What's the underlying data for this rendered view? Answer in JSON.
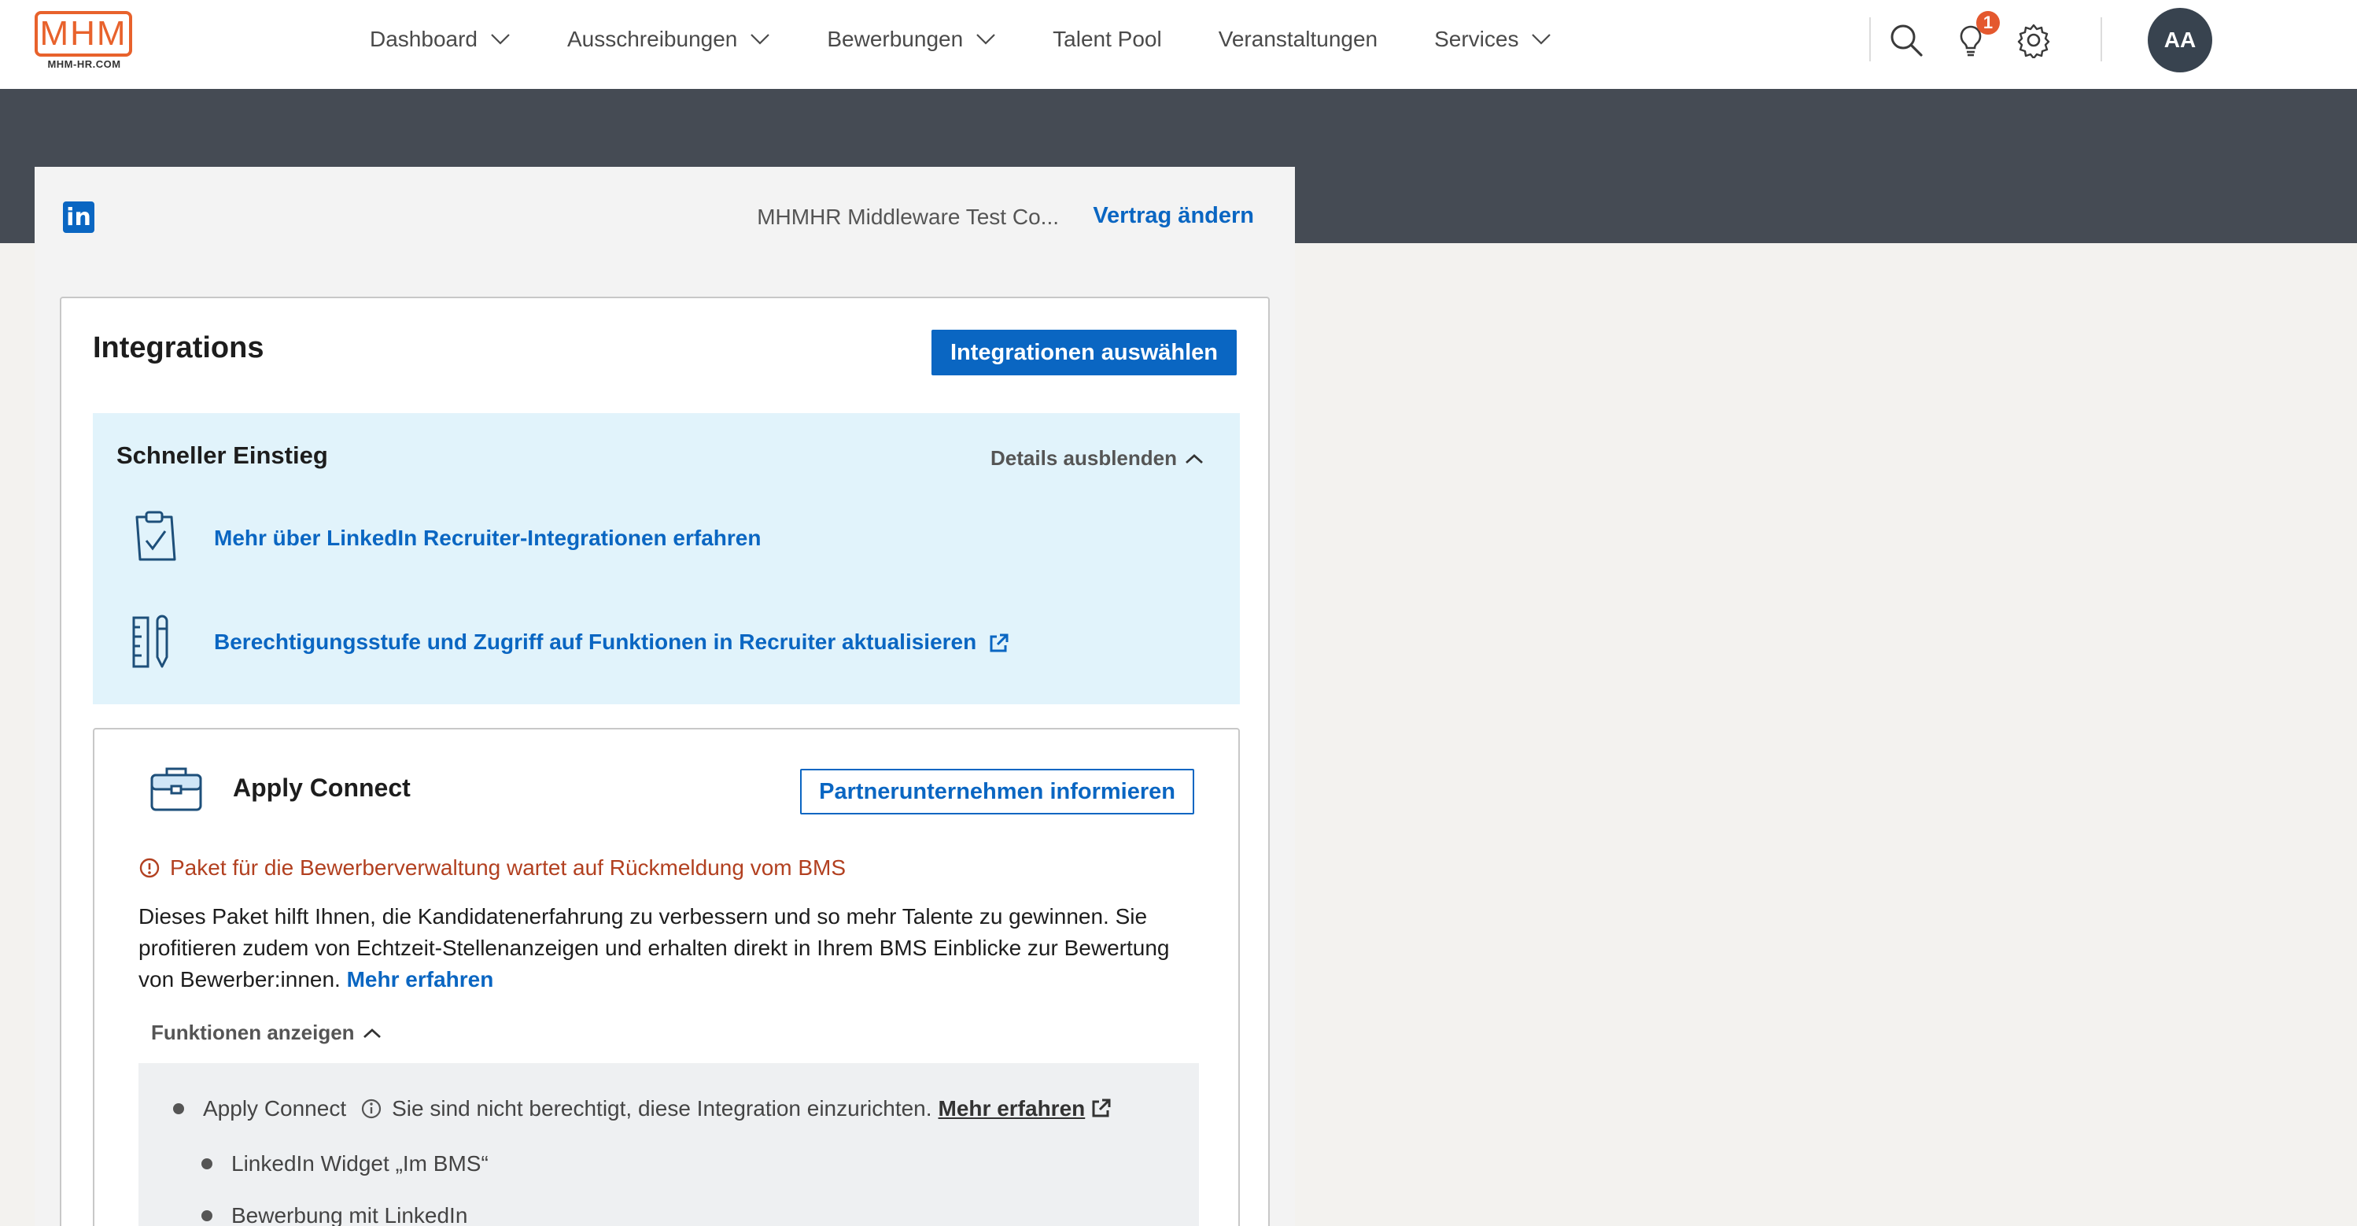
{
  "brand": {
    "logo_text": "MHM",
    "logo_subtext": "MHM-HR.COM",
    "accent": "#e8622c"
  },
  "nav": {
    "items": [
      {
        "label": "Dashboard",
        "has_dropdown": true
      },
      {
        "label": "Ausschreibungen",
        "has_dropdown": true
      },
      {
        "label": "Bewerbungen",
        "has_dropdown": true
      },
      {
        "label": "Talent Pool",
        "has_dropdown": false
      },
      {
        "label": "Veranstaltungen",
        "has_dropdown": false
      },
      {
        "label": "Services",
        "has_dropdown": true
      }
    ],
    "notification_count": "1",
    "avatar_initials": "AA"
  },
  "contract": {
    "name": "MHMHR Middleware Test Co...",
    "change_link": "Vertrag ändern"
  },
  "integrations": {
    "title": "Integrations",
    "select_button": "Integrationen auswählen",
    "quick_start": {
      "title": "Schneller Einstieg",
      "toggle": "Details ausblenden",
      "links": [
        {
          "icon": "clipboard-check-icon",
          "label": "Mehr über LinkedIn Recruiter-Integrationen erfahren",
          "external": false
        },
        {
          "icon": "ruler-pencil-icon",
          "label": "Berechtigungsstufe und Zugriff auf Funktionen in Recruiter aktualisieren",
          "external": true
        }
      ]
    },
    "apply_connect": {
      "title": "Apply Connect",
      "partner_button": "Partnerunternehmen informieren",
      "warning": "Paket für die Bewerberverwaltung wartet auf Rückmeldung vom BMS",
      "description": "Dieses Paket hilft Ihnen, die Kandidatenerfahrung zu verbessern und so mehr Talente zu gewinnen. Sie profitieren zudem von Echtzeit-Stellenanzeigen und erhalten direkt in Ihrem BMS Einblicke zur Bewertung von Bewerber:innen.",
      "more_link": "Mehr erfahren",
      "features_toggle": "Funktionen anzeigen",
      "features": [
        {
          "label": "Apply Connect",
          "note": "Sie sind nicht berechtigt, diese Integration einzurichten.",
          "note_link": "Mehr erfahren"
        },
        {
          "label": "LinkedIn Widget „Im BMS“"
        },
        {
          "label": "Bewerbung mit LinkedIn"
        }
      ]
    }
  },
  "colors": {
    "linkedin_blue": "#0a66c2",
    "banner": "#454b54",
    "quick_start_bg": "#e1f3fb",
    "warning": "#b24020",
    "badge": "#e4582e"
  }
}
